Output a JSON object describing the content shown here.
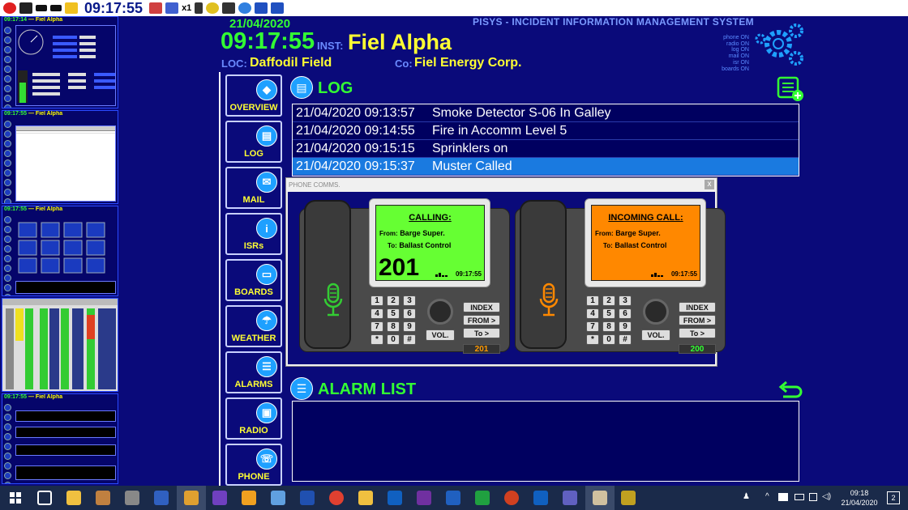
{
  "toolbar": {
    "clock": "09:17:55",
    "zoom": "x1"
  },
  "thumbnails": [
    {
      "time": "09:17:14",
      "inst": "Fiel Alpha",
      "loc": "Daffodil Field",
      "co": "Fiel Energy Corp.",
      "panel": "OVERVIEW"
    },
    {
      "time": "09:17:55",
      "inst": "Fiel Alpha",
      "loc": "Daffodil Field",
      "co": "Fiel Energy Corp.",
      "panel": "CHECK LIST"
    },
    {
      "time": "09:17:55",
      "inst": "Fiel Alpha",
      "loc": "Daffodil Field",
      "co": "Fiel Energy Corp.",
      "panel": "BOARDS"
    },
    {
      "time": "",
      "inst": "",
      "loc": "",
      "co": "",
      "panel": "CHECK LIST"
    },
    {
      "time": "09:17:55",
      "inst": "Fiel Alpha",
      "loc": "Daffodil Field",
      "co": "Fiel Energy Corp.",
      "panel": "ALL MAIL"
    }
  ],
  "header": {
    "date": "21/04/2020",
    "time": "09:17:55",
    "inst_label": "INST:",
    "inst": "Fiel Alpha",
    "loc_label": "LOC:",
    "loc": "Daffodil Field",
    "co_label": "Co:",
    "co": "Fiel Energy Corp.",
    "system_title": "PISYS - INCIDENT INFORMATION MANAGEMENT SYSTEM"
  },
  "status": [
    "phone ON",
    "radio ON",
    "log ON",
    "mail ON",
    "isr ON",
    "boards ON"
  ],
  "nav": [
    {
      "label": "OVERVIEW",
      "icon": "diamond-icon"
    },
    {
      "label": "LOG",
      "icon": "log-icon"
    },
    {
      "label": "MAIL",
      "icon": "mail-icon"
    },
    {
      "label": "ISRs",
      "icon": "info-icon"
    },
    {
      "label": "BOARDS",
      "icon": "board-icon"
    },
    {
      "label": "WEATHER",
      "icon": "weather-icon"
    },
    {
      "label": "ALARMS",
      "icon": "list-icon"
    },
    {
      "label": "RADIO",
      "icon": "radio-icon"
    },
    {
      "label": "PHONE",
      "icon": "phone-icon"
    }
  ],
  "log": {
    "title": "LOG",
    "entries": [
      {
        "timestamp": "21/04/2020 09:13:57",
        "text": "Smoke Detector S-06 In Galley"
      },
      {
        "timestamp": "21/04/2020 09:14:55",
        "text": "Fire in Accomm Level 5"
      },
      {
        "timestamp": "21/04/2020 09:15:15",
        "text": "Sprinklers on"
      },
      {
        "timestamp": "21/04/2020 09:15:37",
        "text": "Muster Called"
      }
    ],
    "selected": 3
  },
  "alarm_list": {
    "title": "ALARM LIST"
  },
  "phone_dialog": {
    "title": "PHONE COMMS.",
    "close": "x",
    "phones": [
      {
        "screen_color": "#66ff33",
        "mic_color": "#33cc33",
        "heading": "CALLING:",
        "from_label": "From:",
        "from": "Barge Super.",
        "to_label": "To:",
        "to": "Ballast Control",
        "number": "201",
        "screen_time": "09:17:55",
        "display_value": "201",
        "display_color": "#ff9900"
      },
      {
        "screen_color": "#ff8800",
        "mic_color": "#ff8800",
        "heading": "INCOMING CALL:",
        "from_label": "From:",
        "from": "Barge Super.",
        "to_label": "To:",
        "to": "Ballast Control",
        "number": "",
        "screen_time": "09:17:55",
        "display_value": "200",
        "display_color": "#33ff33"
      }
    ],
    "keys": [
      "1",
      "2",
      "3",
      "4",
      "5",
      "6",
      "7",
      "8",
      "9",
      "*",
      "0",
      "#"
    ],
    "vol": "VOL.",
    "index": "INDEX",
    "from_btn": "FROM >",
    "to_btn": "To >"
  },
  "taskbar": {
    "time": "09:18",
    "date": "21/04/2020",
    "notifications": "2"
  }
}
